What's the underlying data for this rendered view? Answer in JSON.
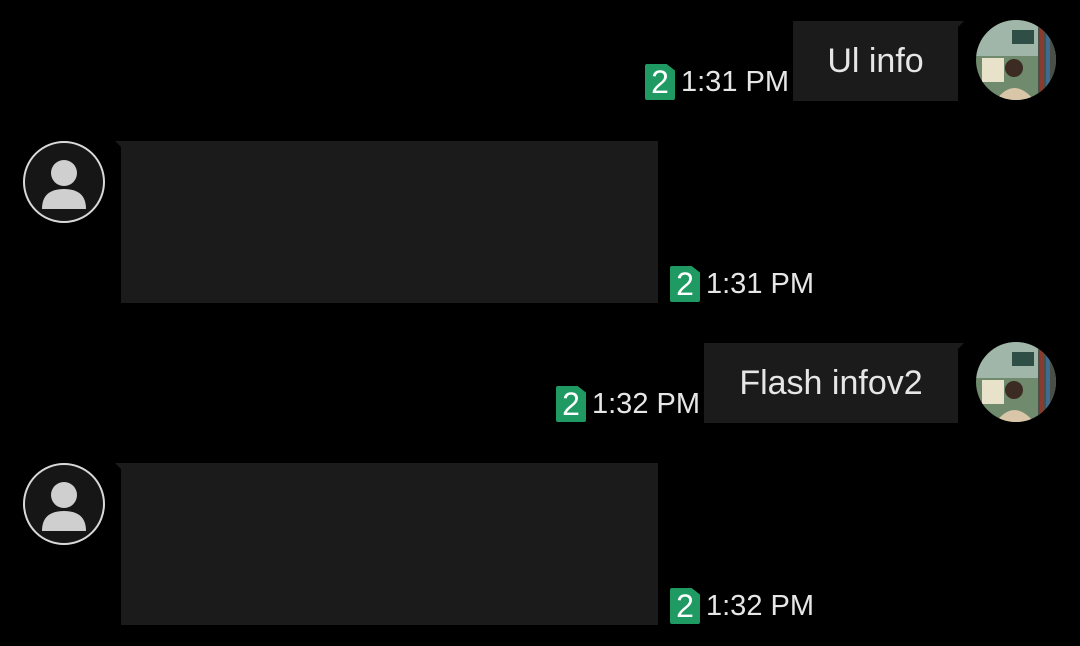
{
  "messages": [
    {
      "direction": "sent",
      "text": "Ul info",
      "sim": "2",
      "time": "1:31 PM"
    },
    {
      "direction": "received",
      "text": "",
      "sim": "2",
      "time": "1:31 PM"
    },
    {
      "direction": "sent",
      "text": "Flash infov2",
      "sim": "2",
      "time": "1:32 PM"
    },
    {
      "direction": "received",
      "text": "",
      "sim": "2",
      "time": "1:32 PM"
    }
  ],
  "icons": {
    "sent_avatar": "user-photo-avatar",
    "received_avatar": "default-contact-avatar",
    "sim_indicator": "sim-2-icon"
  },
  "colors": {
    "background": "#000000",
    "bubble": "#1b1b1b",
    "sim_badge": "#1f9a63"
  }
}
